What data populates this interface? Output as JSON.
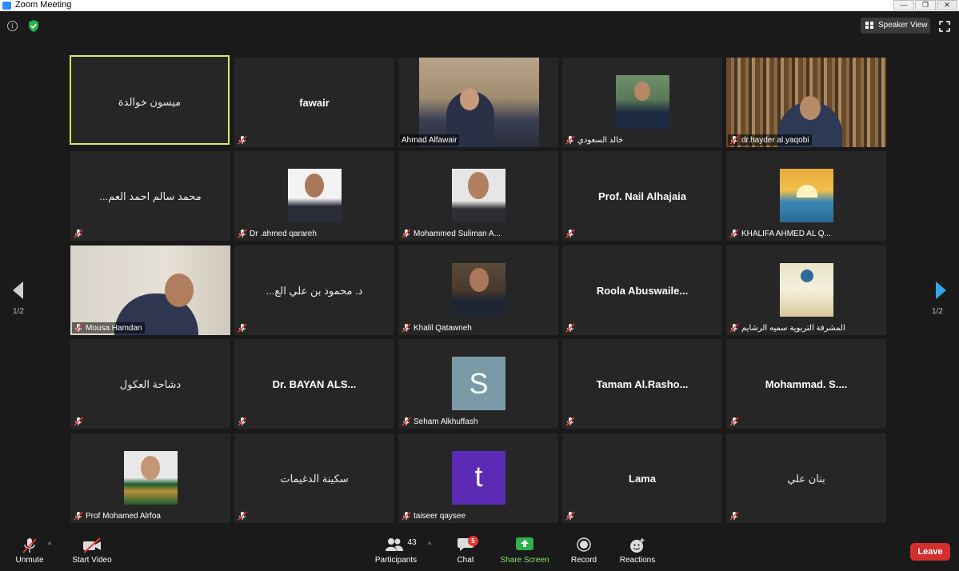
{
  "window": {
    "title": "Zoom Meeting",
    "controls": [
      "—",
      "❐",
      "✕"
    ]
  },
  "top": {
    "speaker_view_label": "Speaker View"
  },
  "pagination": {
    "left": "1/2",
    "right": "1/2"
  },
  "tiles": [
    {
      "name": "ميسون خوالدة",
      "style": "light",
      "active": true
    },
    {
      "name": "fawair",
      "style": "bold",
      "active": false
    },
    {
      "name": "Ahmad Alfawair",
      "style": "video"
    },
    {
      "name": "خالد السعودي",
      "style": "photo"
    },
    {
      "name": "dr.hayder al.yaqobi",
      "style": "video"
    },
    {
      "name": "...محمد سالم احمد العم",
      "style": "light"
    },
    {
      "name": "Dr .ahmed qarareh",
      "style": "photo"
    },
    {
      "name": "Mohammed Suliman A...",
      "style": "photo"
    },
    {
      "name": "Prof. Nail Alhajaia",
      "style": "bold"
    },
    {
      "name": "KHALIFA AHMED AL Q...",
      "style": "photo"
    },
    {
      "name": "Mousa Hamdan",
      "style": "video"
    },
    {
      "name": "...د. محمود بن علي الع",
      "style": "light"
    },
    {
      "name": "Khalil Qatawneh",
      "style": "photo"
    },
    {
      "name": "Roola  Abuswaile...",
      "style": "bold"
    },
    {
      "name": "المشرفة التربوية سميه الرشايم",
      "style": "photo"
    },
    {
      "name": "دشاحة العكول",
      "style": "light"
    },
    {
      "name": "Dr. BAYAN  ALS...",
      "style": "bold"
    },
    {
      "name": "Seham Alkhuffash",
      "style": "avatar",
      "initial": "S",
      "avatar_color": "#7a9aa8"
    },
    {
      "name": "Tamam  Al.Rasho...",
      "style": "bold"
    },
    {
      "name": "Mohammad.  S....",
      "style": "bold"
    },
    {
      "name": "Prof Mohamed Alrfoa",
      "style": "photo"
    },
    {
      "name": "سكينة الدغيمات",
      "style": "light"
    },
    {
      "name": "taiseer qaysee",
      "style": "avatar",
      "initial": "t",
      "avatar_color": "#5b2bb5"
    },
    {
      "name": "Lama",
      "style": "bold"
    },
    {
      "name": "بنان علي",
      "style": "light"
    }
  ],
  "toolbar": {
    "unmute": "Unmute",
    "start_video": "Start Video",
    "participants": "Participants",
    "participants_count": "43",
    "chat": "Chat",
    "chat_badge": "5",
    "share_screen": "Share Screen",
    "record": "Record",
    "reactions": "Reactions",
    "leave": "Leave"
  }
}
